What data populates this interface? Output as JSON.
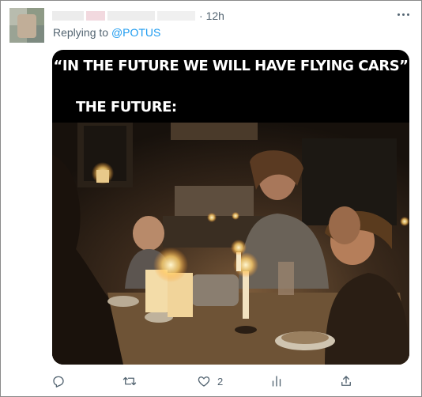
{
  "tweet": {
    "timestamp": "12h",
    "replying_prefix": "Replying to",
    "replying_handle": "@POTUS"
  },
  "meme": {
    "caption_top": "“IN THE FUTURE WE WILL HAVE FLYING CARS”",
    "caption_bottom": "THE FUTURE:"
  },
  "actions": {
    "like_count": "2"
  },
  "icons": [
    "more-icon",
    "reply-icon",
    "retweet-icon",
    "like-icon",
    "share-icon"
  ],
  "colors": {
    "muted": "#536471",
    "link": "#1d9bf0"
  }
}
